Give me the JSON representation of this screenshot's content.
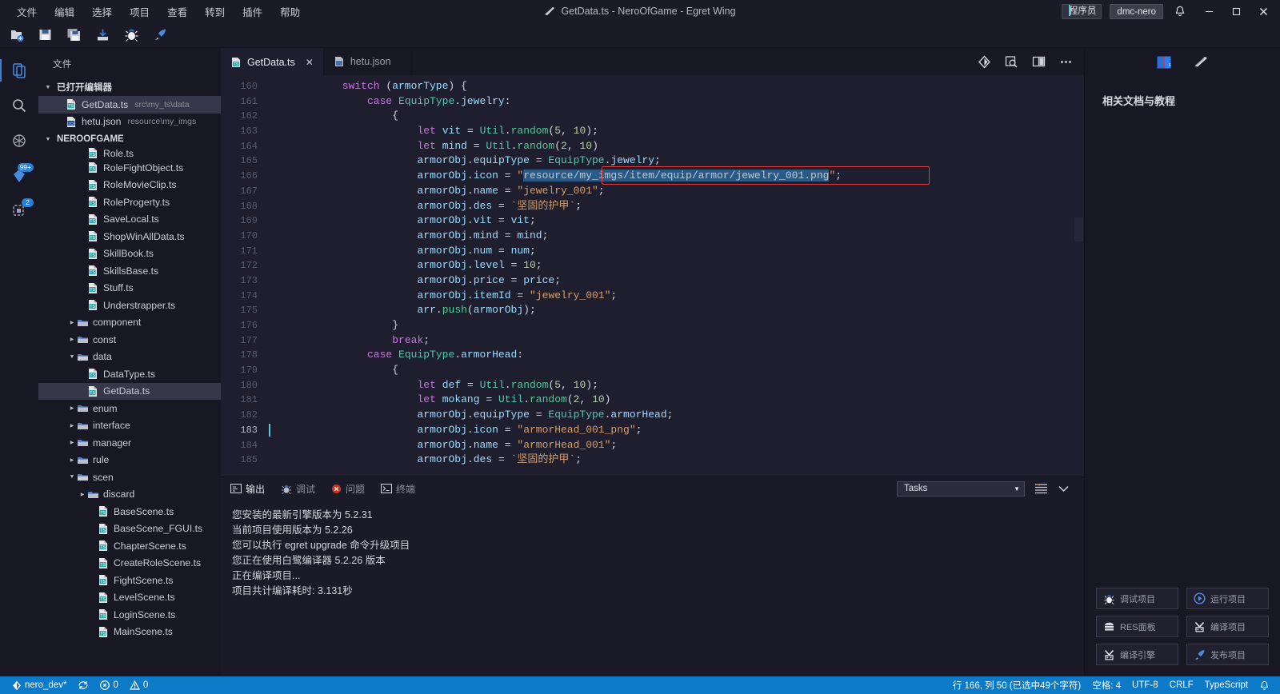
{
  "titlebar": {
    "menus": [
      "文件",
      "编辑",
      "选择",
      "项目",
      "查看",
      "转到",
      "插件",
      "帮助"
    ],
    "window_title": "GetData.ts - NeroOfGame - Egret Wing",
    "role_select": "程序员",
    "user": "dmc-nero",
    "minimize": "—",
    "maximize": "▢",
    "close": "✕"
  },
  "toolstrip": {
    "icons": [
      "new-file-icon",
      "save-icon",
      "save-all-icon",
      "import-icon",
      "debug-bug-icon",
      "rocket-run-icon"
    ]
  },
  "activitybar": {
    "items": [
      {
        "name": "explorer-icon",
        "badge": ""
      },
      {
        "name": "search-icon",
        "badge": ""
      },
      {
        "name": "extensions-icon",
        "badge": ""
      },
      {
        "name": "source-control-icon",
        "badge": "99+"
      },
      {
        "name": "debug-icon",
        "badge": "2"
      }
    ]
  },
  "sidebar": {
    "title": "文件",
    "open_editors": {
      "label": "已打开编辑器",
      "files": [
        {
          "name": "GetData.ts",
          "path": "src\\my_ts\\data",
          "selected": true
        },
        {
          "name": "hetu.json",
          "path": "resource\\my_imgs",
          "selected": false
        }
      ]
    },
    "project": {
      "label": "NEROOFGAME",
      "items": [
        {
          "label": "Role.ts",
          "type": "ts",
          "indent": 3,
          "clipped": true
        },
        {
          "label": "RoleFightObject.ts",
          "type": "ts",
          "indent": 3
        },
        {
          "label": "RoleMovieClip.ts",
          "type": "ts",
          "indent": 3
        },
        {
          "label": "RoleProgerty.ts",
          "type": "ts",
          "indent": 3
        },
        {
          "label": "SaveLocal.ts",
          "type": "ts",
          "indent": 3
        },
        {
          "label": "ShopWinAllData.ts",
          "type": "ts",
          "indent": 3
        },
        {
          "label": "SkillBook.ts",
          "type": "ts",
          "indent": 3
        },
        {
          "label": "SkillsBase.ts",
          "type": "ts",
          "indent": 3
        },
        {
          "label": "Stuff.ts",
          "type": "ts",
          "indent": 3
        },
        {
          "label": "Understrapper.ts",
          "type": "ts",
          "indent": 3
        },
        {
          "label": "component",
          "type": "folder",
          "indent": 2,
          "expanded": false
        },
        {
          "label": "const",
          "type": "folder",
          "indent": 2,
          "expanded": false
        },
        {
          "label": "data",
          "type": "folder-open",
          "indent": 2,
          "expanded": true
        },
        {
          "label": "DataType.ts",
          "type": "ts",
          "indent": 3
        },
        {
          "label": "GetData.ts",
          "type": "ts",
          "indent": 3,
          "selected": true
        },
        {
          "label": "enum",
          "type": "folder",
          "indent": 2,
          "expanded": false
        },
        {
          "label": "interface",
          "type": "folder",
          "indent": 2,
          "expanded": false
        },
        {
          "label": "manager",
          "type": "folder",
          "indent": 2,
          "expanded": false
        },
        {
          "label": "rule",
          "type": "folder",
          "indent": 2,
          "expanded": false
        },
        {
          "label": "scen",
          "type": "folder-open",
          "indent": 2,
          "expanded": true
        },
        {
          "label": "discard",
          "type": "folder",
          "indent": 3,
          "expanded": false
        },
        {
          "label": "BaseScene.ts",
          "type": "ts",
          "indent": 4
        },
        {
          "label": "BaseScene_FGUI.ts",
          "type": "ts",
          "indent": 4
        },
        {
          "label": "ChapterScene.ts",
          "type": "ts",
          "indent": 4
        },
        {
          "label": "CreateRoleScene.ts",
          "type": "ts",
          "indent": 4
        },
        {
          "label": "FightScene.ts",
          "type": "ts",
          "indent": 4
        },
        {
          "label": "LevelScene.ts",
          "type": "ts",
          "indent": 4
        },
        {
          "label": "LoginScene.ts",
          "type": "ts",
          "indent": 4
        },
        {
          "label": "MainScene.ts",
          "type": "ts",
          "indent": 4,
          "clipped": true
        }
      ]
    }
  },
  "editor": {
    "tabs": [
      {
        "label": "GetData.ts",
        "active": true,
        "closable": true
      },
      {
        "label": "hetu.json",
        "active": false,
        "closable": false
      }
    ],
    "actions": [
      "egret-icon",
      "preview-icon",
      "split-editor-icon",
      "more-actions-icon"
    ],
    "first_line_number": 160,
    "cursor_line": 183,
    "lines": [
      {
        "n": 160,
        "code": "            switch (armorType) {"
      },
      {
        "n": 161,
        "code": "                case EquipType.jewelry:"
      },
      {
        "n": 162,
        "code": "                    {"
      },
      {
        "n": 163,
        "code": "                        let vit = Util.random(5, 10);"
      },
      {
        "n": 164,
        "code": "                        let mind = Util.random(2, 10)"
      },
      {
        "n": 165,
        "code": "                        armorObj.equipType = EquipType.jewelry;"
      },
      {
        "n": 166,
        "code": "                        armorObj.icon = \"resource/my_imgs/item/equip/armor/jewelry_001.png\";"
      },
      {
        "n": 167,
        "code": "                        armorObj.name = \"jewelry_001\";"
      },
      {
        "n": 168,
        "code": "                        armorObj.des = `坚固的护甲`;"
      },
      {
        "n": 169,
        "code": "                        armorObj.vit = vit;"
      },
      {
        "n": 170,
        "code": "                        armorObj.mind = mind;"
      },
      {
        "n": 171,
        "code": "                        armorObj.num = num;"
      },
      {
        "n": 172,
        "code": "                        armorObj.level = 10;"
      },
      {
        "n": 173,
        "code": "                        armorObj.price = price;"
      },
      {
        "n": 174,
        "code": "                        armorObj.itemId = \"jewelry_001\";"
      },
      {
        "n": 175,
        "code": "                        arr.push(armorObj);"
      },
      {
        "n": 176,
        "code": "                    }"
      },
      {
        "n": 177,
        "code": "                    break;"
      },
      {
        "n": 178,
        "code": "                case EquipType.armorHead:"
      },
      {
        "n": 179,
        "code": "                    {"
      },
      {
        "n": 180,
        "code": "                        let def = Util.random(5, 10);"
      },
      {
        "n": 181,
        "code": "                        let mokang = Util.random(2, 10)"
      },
      {
        "n": 182,
        "code": "                        armorObj.equipType = EquipType.armorHead;"
      },
      {
        "n": 183,
        "code": "                        armorObj.icon = \"armorHead_001_png\";"
      },
      {
        "n": 184,
        "code": "                        armorObj.name = \"armorHead_001\";"
      },
      {
        "n": 185,
        "code": "                        armorObj.des = `坚固的护甲`;"
      }
    ],
    "selected_text": "resource/my_imgs/item/equip/armor/jewelry_001.png"
  },
  "panel": {
    "tabs": [
      {
        "label": "输出",
        "icon": "output-icon",
        "active": true
      },
      {
        "label": "调试",
        "icon": "debug-bug-icon",
        "active": false
      },
      {
        "label": "问题",
        "icon": "error-icon",
        "active": false
      },
      {
        "label": "终端",
        "icon": "terminal-icon",
        "active": false
      }
    ],
    "task_select": "Tasks",
    "panel_actions": [
      "clear-output-icon",
      "collapse-panel-icon"
    ],
    "output": [
      "您安装的最新引擎版本为 5.2.31",
      "当前项目使用版本为 5.2.26",
      "您可以执行 egret upgrade 命令升级项目",
      "您正在使用白鹭编译器 5.2.26 版本",
      "正在编译项目...",
      "项目共计编译耗时: 3.131秒"
    ]
  },
  "rightpanel": {
    "head_icons": [
      "docs-book-icon",
      "egret-wing-icon"
    ],
    "title": "相关文档与教程",
    "buttons": [
      {
        "label": "调试项目",
        "icon": "debug-bug-icon"
      },
      {
        "label": "运行项目",
        "icon": "play-icon"
      },
      {
        "label": "RES面板",
        "icon": "res-panel-icon"
      },
      {
        "label": "编译项目",
        "icon": "compile-icon"
      },
      {
        "label": "编译引擎",
        "icon": "compile-icon"
      },
      {
        "label": "发布项目",
        "icon": "rocket-run-icon"
      }
    ]
  },
  "statusbar": {
    "branch": "nero_dev*",
    "sync_icon": "sync-icon",
    "errors": "0",
    "warnings": "0",
    "position": "行 166, 列 50 (已选中49个字符)",
    "indentation": "空格: 4",
    "encoding": "UTF-8",
    "eol": "CRLF",
    "language": "TypeScript",
    "bell": "bell-icon",
    "accent_color": "#0d7ac7"
  }
}
